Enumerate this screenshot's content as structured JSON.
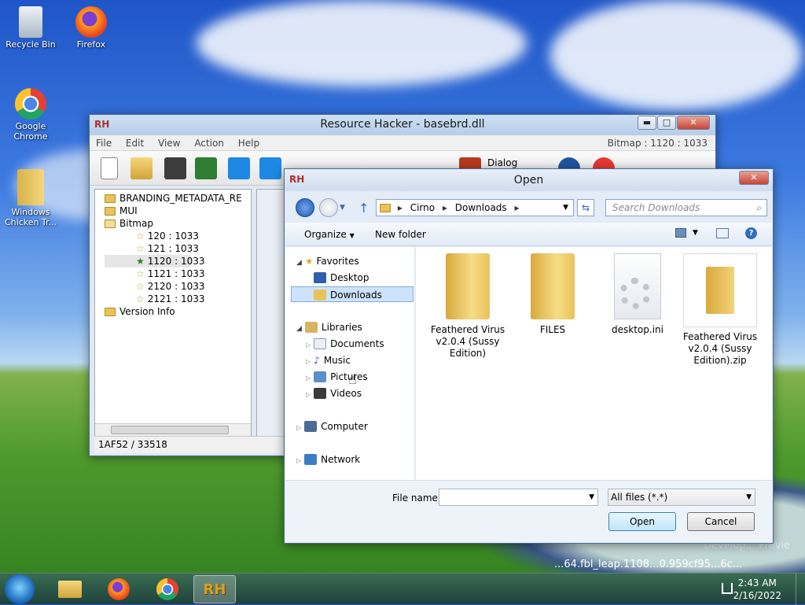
{
  "desktop": {
    "icons": [
      {
        "label": "Recycle Bin"
      },
      {
        "label": "Firefox"
      },
      {
        "label": "Google Chrome"
      },
      {
        "label": "Windows Chicken Tr..."
      }
    ],
    "watermark": "Develop... Previe",
    "watermark2": "...64.fbl_leap.1108...0.959cf95...6c..."
  },
  "rh": {
    "title": "Resource Hacker - basebrd.dll",
    "logo": "RH",
    "menu": [
      "File",
      "Edit",
      "View",
      "Action",
      "Help"
    ],
    "bitmap_info": "Bitmap : 1120 : 1033",
    "dialog_label": "Dialog",
    "tree": [
      {
        "label": "BRANDING_METADATA_RE",
        "type": "folder"
      },
      {
        "label": "MUI",
        "type": "folder"
      },
      {
        "label": "Bitmap",
        "type": "folder"
      },
      {
        "label": "120 : 1033",
        "type": "star"
      },
      {
        "label": "121 : 1033",
        "type": "star"
      },
      {
        "label": "1120 : 1033",
        "type": "star-selected"
      },
      {
        "label": "1121 : 1033",
        "type": "star"
      },
      {
        "label": "2120 : 1033",
        "type": "star"
      },
      {
        "label": "2121 : 1033",
        "type": "star"
      },
      {
        "label": "Version Info",
        "type": "folder"
      }
    ],
    "status": "1AF52 / 33518",
    "minimize": "▬",
    "maximize": "□",
    "close": "✕"
  },
  "open": {
    "title": "Open",
    "close": "✕",
    "breadcrumb": [
      "Cirno",
      "Downloads"
    ],
    "search_placeholder": "Search Downloads",
    "organize": "Organize",
    "new_folder": "New folder",
    "nav": {
      "favorites": "Favorites",
      "fav_items": [
        "Desktop",
        "Downloads"
      ],
      "libraries": "Libraries",
      "lib_items": [
        "Documents",
        "Music",
        "Pictures",
        "Videos"
      ],
      "computer": "Computer",
      "network": "Network"
    },
    "files": [
      {
        "label": "Feathered Virus v2.0.4 (Sussy Edition)",
        "kind": "folder"
      },
      {
        "label": "FILES",
        "kind": "folder"
      },
      {
        "label": "desktop.ini",
        "kind": "ini"
      },
      {
        "label": "Feathered Virus v2.0.4 (Sussy Edition).zip",
        "kind": "zip"
      }
    ],
    "file_name_label": "File name:",
    "file_name_value": "",
    "filter": "All files (*.*)",
    "open_button": "Open",
    "cancel_button": "Cancel"
  },
  "taskbar": {
    "time": "2:43 AM",
    "date": "2/16/2022",
    "rh_label": "RH"
  }
}
